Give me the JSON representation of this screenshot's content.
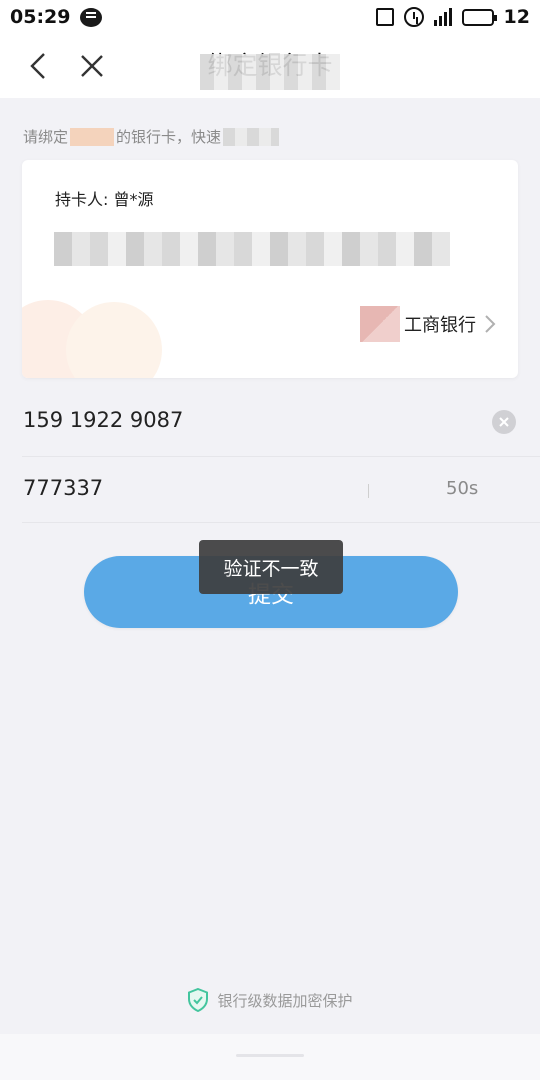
{
  "status_bar": {
    "time": "05:29",
    "network": "4G",
    "battery": "12"
  },
  "nav": {
    "title": "绑定银行卡"
  },
  "hint": {
    "prefix": "请绑定",
    "middle": "的银行卡，快速"
  },
  "card": {
    "holder": "持卡人: 曾*源",
    "bank_name": "工商银行"
  },
  "form": {
    "phone_value": "159 1922 9087",
    "code_value": "777337",
    "countdown": "50s"
  },
  "submit": {
    "label": "提交"
  },
  "toast": {
    "message": "验证不一致"
  },
  "footer": {
    "security_text": "银行级数据加密保护"
  },
  "colors": {
    "accent": "#5aa9e6",
    "toast_bg": "#3e3e3e",
    "shield": "#43c59e"
  }
}
